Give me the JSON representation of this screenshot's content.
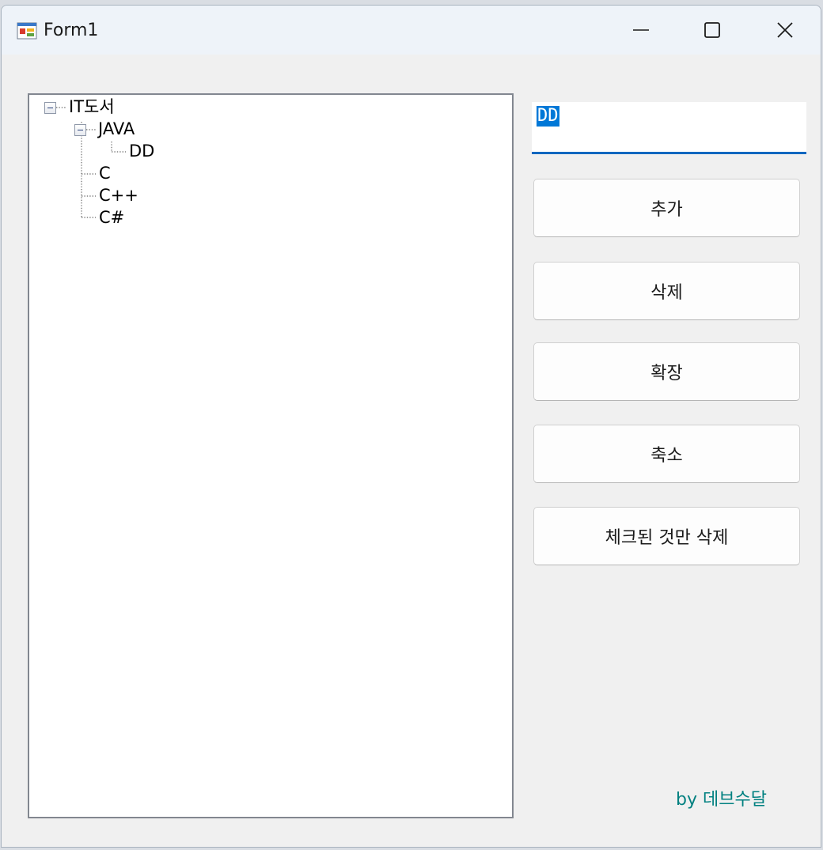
{
  "window": {
    "title": "Form1",
    "app_icon": "winforms-app-icon",
    "controls": [
      "minimize-icon",
      "maximize-icon",
      "close-icon"
    ]
  },
  "tree": {
    "nodes": [
      {
        "label": "IT도서",
        "level": 0,
        "expanded": true
      },
      {
        "label": "JAVA",
        "level": 1,
        "expanded": true
      },
      {
        "label": "DD",
        "level": 2,
        "expanded": false
      },
      {
        "label": "C",
        "level": 1,
        "expanded": false
      },
      {
        "label": "C++",
        "level": 1,
        "expanded": false
      },
      {
        "label": "C#",
        "level": 1,
        "expanded": false
      }
    ]
  },
  "textbox": {
    "value": "DD",
    "selected": true
  },
  "buttons": {
    "add": "추가",
    "delete": "삭제",
    "expand": "확장",
    "collapse": "축소",
    "delete_checked": "체크된 것만 삭제"
  },
  "footer": {
    "credit": "by 데브수달"
  },
  "colors": {
    "accent": "#0067c0",
    "selection": "#0078d7",
    "credit": "#008080",
    "window_bg": "#f0f0f0"
  }
}
